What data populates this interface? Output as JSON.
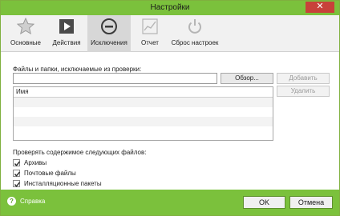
{
  "window": {
    "title": "Настройки",
    "close_glyph": "✕"
  },
  "tabs": [
    {
      "label": "Основные",
      "icon": "star-icon",
      "active": false
    },
    {
      "label": "Действия",
      "icon": "play-icon",
      "active": false
    },
    {
      "label": "Исключения",
      "icon": "minus-circle-icon",
      "active": true
    },
    {
      "label": "Отчет",
      "icon": "chart-icon",
      "active": false
    },
    {
      "label": "Сброс настроек",
      "icon": "reset-icon",
      "active": false
    }
  ],
  "exclusions": {
    "label": "Файлы и папки, исключаемые из проверки:",
    "path_value": "",
    "browse_label": "Обзор...",
    "add_label": "Добавить",
    "delete_label": "Удалить",
    "list_header": "Имя",
    "rows": [
      "",
      "",
      "",
      ""
    ]
  },
  "check": {
    "label": "Проверять содержимое следующих файлов:",
    "items": [
      {
        "label": "Архивы",
        "checked": true
      },
      {
        "label": "Почтовые файлы",
        "checked": true
      },
      {
        "label": "Инсталляционные пакеты",
        "checked": true
      }
    ]
  },
  "footer": {
    "help_label": "Справка",
    "ok_label": "OK",
    "cancel_label": "Отмена"
  },
  "colors": {
    "accent": "#7bc13c",
    "close": "#c8413a"
  }
}
